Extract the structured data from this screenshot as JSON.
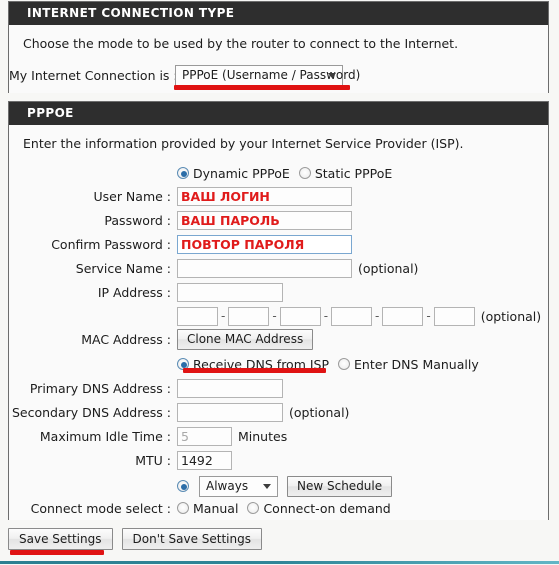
{
  "internet_connection_type": {
    "header": "INTERNET CONNECTION TYPE",
    "intro": "Choose the mode to be used by the router to connect to the Internet.",
    "connection_label": "My Internet Connection is :",
    "connection_value": "PPPoE (Username / Password)",
    "caret_icon": "chevron-down-icon"
  },
  "pppoe": {
    "header": "PPPOE",
    "intro": "Enter the information provided by your Internet Service Provider (ISP).",
    "mode_radios": [
      {
        "label": "Dynamic PPPoE",
        "selected": true
      },
      {
        "label": "Static PPPoE",
        "selected": false
      }
    ],
    "fields": {
      "user_name_label": "User Name :",
      "user_name_value": "ВАШ ЛОГИН",
      "password_label": "Password :",
      "password_value": "ВАШ ПАРОЛЬ",
      "confirm_password_label": "Confirm Password :",
      "confirm_password_value": "ПОВТОР ПАРОЛЯ",
      "service_name_label": "Service Name :",
      "service_name_value": "",
      "service_name_note": "(optional)",
      "ip_address_label": "IP Address :",
      "ip_address_value": "",
      "mac_address_label": "MAC Address :",
      "mac_octets": [
        "",
        "",
        "",
        "",
        "",
        ""
      ],
      "mac_separator": "-",
      "mac_note": "(optional)",
      "clone_mac_button": "Clone MAC Address",
      "primary_dns_label": "Primary DNS Address :",
      "primary_dns_value": "",
      "secondary_dns_label": "Secondary DNS Address :",
      "secondary_dns_value": "",
      "secondary_dns_note": "(optional)",
      "max_idle_label": "Maximum Idle Time :",
      "max_idle_value": "5",
      "max_idle_unit": "Minutes",
      "mtu_label": "MTU :",
      "mtu_value": "1492"
    },
    "dns_radios": [
      {
        "label": "Receive DNS from ISP",
        "selected": true
      },
      {
        "label": "Enter DNS Manually",
        "selected": false
      }
    ],
    "connect_mode": {
      "label": "Connect mode select :",
      "always_selected": true,
      "always_value": "Always",
      "new_schedule_button": "New Schedule",
      "manual_label": "Manual",
      "manual_selected": false,
      "on_demand_label": "Connect-on demand",
      "on_demand_selected": false
    }
  },
  "actions": {
    "save_label": "Save Settings",
    "dont_save_label": "Don't Save Settings"
  },
  "colors": {
    "header_bg": "#2e2e2e",
    "annotation_red": "#e01313",
    "value_red": "#e01b1b",
    "radio_blue": "#2b6da8",
    "footer_teal": "#2f8698"
  }
}
